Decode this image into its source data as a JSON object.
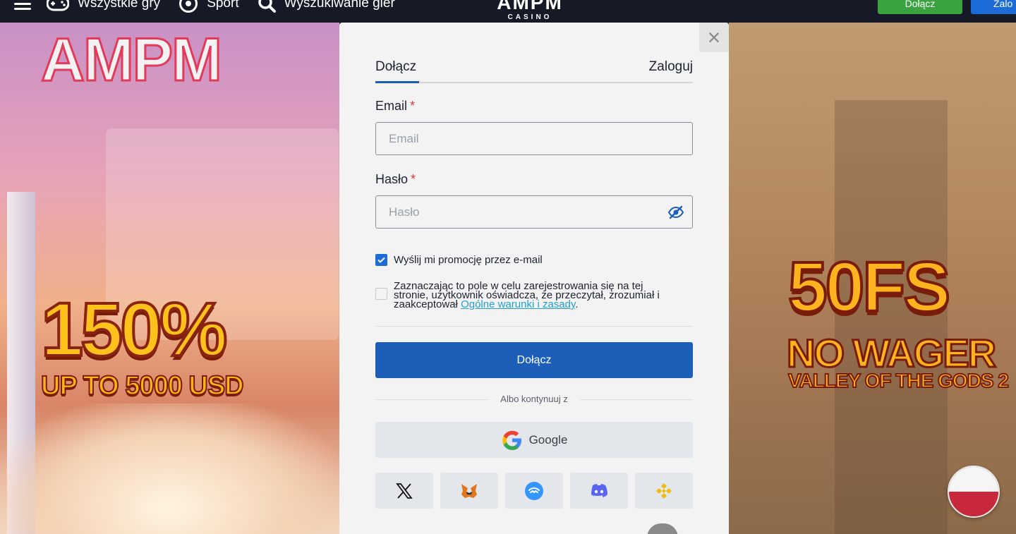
{
  "topbar": {
    "nav": [
      {
        "label": "Wszystkie gry",
        "icon": "gamepad-icon"
      },
      {
        "label": "Sport",
        "icon": "soccer-ball-icon"
      },
      {
        "label": "Wyszukiwanie gier",
        "icon": "search-icon"
      }
    ],
    "logo_main": "AMPM",
    "logo_sub": "CASINO",
    "join_label": "Dołącz",
    "login_label": "Zalo"
  },
  "banner_left": {
    "logo": "AMPM",
    "bonus": "150%",
    "bonus_sub": "UP TO 5000 USD"
  },
  "banner_right": {
    "headline": "50FS",
    "sub": "NO WAGER",
    "game": "VALLEY OF THE GODS 2"
  },
  "modal": {
    "tabs": {
      "join": "Dołącz",
      "login": "Zaloguj"
    },
    "email_label": "Email",
    "email_placeholder": "Email",
    "password_label": "Hasło",
    "password_placeholder": "Hasło",
    "required_mark": "*",
    "promo_checkbox": {
      "label": "Wyślij mi promocję przez e-mail",
      "checked": true
    },
    "terms_checkbox": {
      "line1": "Zaznaczając to pole w celu zarejestrowania się na tej",
      "line2": "stronie, użytkownik oświadcza, że przeczytał, zrozumiał i",
      "line3_prefix": "zaakceptował ",
      "link": "Ogólne warunki i zasady",
      "suffix": ".",
      "checked": false
    },
    "submit_label": "Dołącz",
    "or_text": "Albo kontynuuj z",
    "google_label": "Google",
    "socials": [
      {
        "name": "x-icon"
      },
      {
        "name": "metamask-icon"
      },
      {
        "name": "walletconnect-icon"
      },
      {
        "name": "discord-icon"
      },
      {
        "name": "binance-icon"
      }
    ]
  },
  "colors": {
    "primary": "#1d5fb8",
    "join_green": "#3aa340",
    "link": "#1da1d6",
    "required": "#d93a3a"
  }
}
